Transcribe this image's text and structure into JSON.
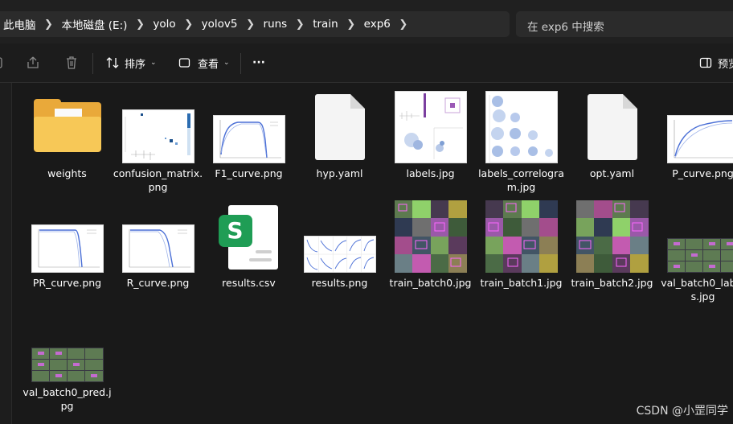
{
  "breadcrumbs": [
    "此电脑",
    "本地磁盘 (E:)",
    "yolo",
    "yolov5",
    "runs",
    "train",
    "exp6"
  ],
  "search": {
    "placeholder": "在 exp6 中搜索"
  },
  "toolbar": {
    "sort_label": "排序",
    "view_label": "查看",
    "more_label": "···",
    "preview_label": "预览"
  },
  "files": [
    {
      "name": "weights",
      "kind": "folder"
    },
    {
      "name": "confusion_matrix.png",
      "kind": "matrix"
    },
    {
      "name": "F1_curve.png",
      "kind": "curve"
    },
    {
      "name": "hyp.yaml",
      "kind": "yaml"
    },
    {
      "name": "labels.jpg",
      "kind": "labels"
    },
    {
      "name": "labels_correlogram.jpg",
      "kind": "correlogram"
    },
    {
      "name": "opt.yaml",
      "kind": "yaml"
    },
    {
      "name": "P_curve.png",
      "kind": "curve"
    },
    {
      "name": "PR_curve.png",
      "kind": "curve-drop"
    },
    {
      "name": "R_curve.png",
      "kind": "curve-drop"
    },
    {
      "name": "results.csv",
      "kind": "csv"
    },
    {
      "name": "results.png",
      "kind": "results"
    },
    {
      "name": "train_batch0.jpg",
      "kind": "mosaic"
    },
    {
      "name": "train_batch1.jpg",
      "kind": "mosaic"
    },
    {
      "name": "train_batch2.jpg",
      "kind": "mosaic"
    },
    {
      "name": "val_batch0_labels.jpg",
      "kind": "valgrid"
    },
    {
      "name": "val_batch0_pred.jpg",
      "kind": "valgrid"
    }
  ],
  "watermark": "CSDN @小罡同学",
  "colors": {
    "background": "#191919",
    "folder": "#f7c857",
    "csv_badge": "#1f9d55"
  }
}
